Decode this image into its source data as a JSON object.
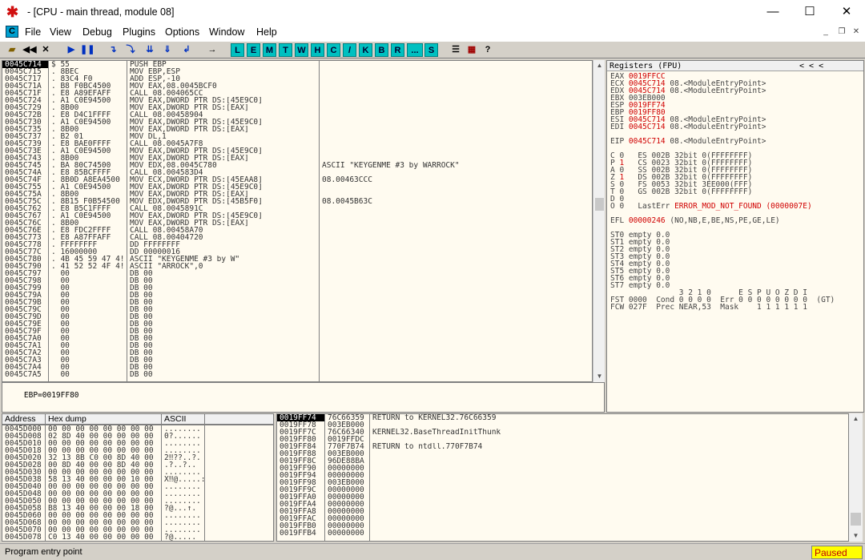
{
  "window": {
    "title": "- [CPU - main thread, module 08]",
    "minimize": "—",
    "maximize": "☐",
    "close": "✕"
  },
  "menu": {
    "c_icon": "C",
    "items": [
      "File",
      "View",
      "Debug",
      "Plugins",
      "Options",
      "Window",
      "Help"
    ],
    "mdi_min": "_",
    "mdi_restore": "❐",
    "mdi_close": "✕"
  },
  "toolbar": {
    "letters": [
      "L",
      "E",
      "M",
      "T",
      "W",
      "H",
      "C",
      "/",
      "K",
      "B",
      "R",
      "...",
      "S"
    ],
    "help": "?"
  },
  "cpu": {
    "rows": [
      {
        "addr": "0045C714",
        "hex": "$ 55",
        "asm": "PUSH EBP",
        "cmt": ""
      },
      {
        "addr": "0045C715",
        "hex": ". 8BEC",
        "asm": "MOV EBP,ESP",
        "cmt": ""
      },
      {
        "addr": "0045C717",
        "hex": ". 83C4 F0",
        "asm": "ADD ESP,-10",
        "cmt": ""
      },
      {
        "addr": "0045C71A",
        "hex": ". B8 F0BC4500",
        "asm": "MOV EAX,08.0045BCF0",
        "cmt": ""
      },
      {
        "addr": "0045C71F",
        "hex": ". E8 A89EFAFF",
        "asm": "CALL 08.004065CC",
        "cmt": ""
      },
      {
        "addr": "0045C724",
        "hex": ". A1 C0E94500",
        "asm": "MOV EAX,DWORD PTR DS:[45E9C0]",
        "cmt": ""
      },
      {
        "addr": "0045C729",
        "hex": ". 8B00",
        "asm": "MOV EAX,DWORD PTR DS:[EAX]",
        "cmt": ""
      },
      {
        "addr": "0045C72B",
        "hex": ". E8 D4C1FFFF",
        "asm": "CALL 08.00458904",
        "cmt": ""
      },
      {
        "addr": "0045C730",
        "hex": ". A1 C0E94500",
        "asm": "MOV EAX,DWORD PTR DS:[45E9C0]",
        "cmt": ""
      },
      {
        "addr": "0045C735",
        "hex": ". 8B00",
        "asm": "MOV EAX,DWORD PTR DS:[EAX]",
        "cmt": ""
      },
      {
        "addr": "0045C737",
        "hex": ". B2 01",
        "asm": "MOV DL,1",
        "cmt": ""
      },
      {
        "addr": "0045C739",
        "hex": ". E8 BAE0FFFF",
        "asm": "CALL 08.0045A7F8",
        "cmt": ""
      },
      {
        "addr": "0045C73E",
        "hex": ". A1 C0E94500",
        "asm": "MOV EAX,DWORD PTR DS:[45E9C0]",
        "cmt": ""
      },
      {
        "addr": "0045C743",
        "hex": ". 8B00",
        "asm": "MOV EAX,DWORD PTR DS:[EAX]",
        "cmt": ""
      },
      {
        "addr": "0045C745",
        "hex": ". BA 80C74500",
        "asm": "MOV EDX,08.0045C780",
        "cmt": "ASCII \"KEYGENME #3 by WARROCK\""
      },
      {
        "addr": "0045C74A",
        "hex": ". E8 85BCFFFF",
        "asm": "CALL 08.004583D4",
        "cmt": ""
      },
      {
        "addr": "0045C74F",
        "hex": ". 8B0D A8EA4500",
        "asm": "MOV ECX,DWORD PTR DS:[45EAA8]",
        "cmt": "08.00463CCC"
      },
      {
        "addr": "0045C755",
        "hex": ". A1 C0E94500",
        "asm": "MOV EAX,DWORD PTR DS:[45E9C0]",
        "cmt": ""
      },
      {
        "addr": "0045C75A",
        "hex": ". 8B00",
        "asm": "MOV EAX,DWORD PTR DS:[EAX]",
        "cmt": ""
      },
      {
        "addr": "0045C75C",
        "hex": ". 8B15 F0B54500",
        "asm": "MOV EDX,DWORD PTR DS:[45B5F0]",
        "cmt": "08.0045B63C"
      },
      {
        "addr": "0045C762",
        "hex": ". E8 B5C1FFFF",
        "asm": "CALL 08.0045891C",
        "cmt": ""
      },
      {
        "addr": "0045C767",
        "hex": ". A1 C0E94500",
        "asm": "MOV EAX,DWORD PTR DS:[45E9C0]",
        "cmt": ""
      },
      {
        "addr": "0045C76C",
        "hex": ". 8B00",
        "asm": "MOV EAX,DWORD PTR DS:[EAX]",
        "cmt": ""
      },
      {
        "addr": "0045C76E",
        "hex": ". E8 FDC2FFFF",
        "asm": "CALL 08.00458A70",
        "cmt": ""
      },
      {
        "addr": "0045C773",
        "hex": ". E8 A87FFAFF",
        "asm": "CALL 08.00404720",
        "cmt": ""
      },
      {
        "addr": "0045C778",
        "hex": ". FFFFFFFF",
        "asm": "DD FFFFFFFF",
        "cmt": ""
      },
      {
        "addr": "0045C77C",
        "hex": ". 16000000",
        "asm": "DD 00000016",
        "cmt": ""
      },
      {
        "addr": "0045C780",
        "hex": ". 4B 45 59 47 4!",
        "asm": "ASCII \"KEYGENME #3 by W\"",
        "cmt": ""
      },
      {
        "addr": "0045C790",
        "hex": ". 41 52 52 4F 4!",
        "asm": "ASCII \"ARROCK\",0",
        "cmt": ""
      },
      {
        "addr": "0045C797",
        "hex": "  00",
        "asm": "DB 00",
        "cmt": ""
      },
      {
        "addr": "0045C798",
        "hex": "  00",
        "asm": "DB 00",
        "cmt": ""
      },
      {
        "addr": "0045C799",
        "hex": "  00",
        "asm": "DB 00",
        "cmt": ""
      },
      {
        "addr": "0045C79A",
        "hex": "  00",
        "asm": "DB 00",
        "cmt": ""
      },
      {
        "addr": "0045C79B",
        "hex": "  00",
        "asm": "DB 00",
        "cmt": ""
      },
      {
        "addr": "0045C79C",
        "hex": "  00",
        "asm": "DB 00",
        "cmt": ""
      },
      {
        "addr": "0045C79D",
        "hex": "  00",
        "asm": "DB 00",
        "cmt": ""
      },
      {
        "addr": "0045C79E",
        "hex": "  00",
        "asm": "DB 00",
        "cmt": ""
      },
      {
        "addr": "0045C79F",
        "hex": "  00",
        "asm": "DB 00",
        "cmt": ""
      },
      {
        "addr": "0045C7A0",
        "hex": "  00",
        "asm": "DB 00",
        "cmt": ""
      },
      {
        "addr": "0045C7A1",
        "hex": "  00",
        "asm": "DB 00",
        "cmt": ""
      },
      {
        "addr": "0045C7A2",
        "hex": "  00",
        "asm": "DB 00",
        "cmt": ""
      },
      {
        "addr": "0045C7A3",
        "hex": "  00",
        "asm": "DB 00",
        "cmt": ""
      },
      {
        "addr": "0045C7A4",
        "hex": "  00",
        "asm": "DB 00",
        "cmt": ""
      },
      {
        "addr": "0045C7A5",
        "hex": "  00",
        "asm": "DB 00",
        "cmt": ""
      }
    ]
  },
  "info": {
    "text": "EBP=0019FF80"
  },
  "registers": {
    "header": "Registers (FPU)",
    "nav": "<   <   <",
    "lines": [
      {
        "t": "EAX ",
        "v": "0019FFCC",
        "r": ""
      },
      {
        "t": "ECX ",
        "v": "0045C714",
        "r": " 08.<ModuleEntryPoint>"
      },
      {
        "t": "EDX ",
        "v": "0045C714",
        "r": " 08.<ModuleEntryPoint>"
      },
      {
        "t": "EBX 003EB000",
        "v": "",
        "r": ""
      },
      {
        "t": "ESP ",
        "v": "0019FF74",
        "r": ""
      },
      {
        "t": "EBP ",
        "v": "0019FF80",
        "r": ""
      },
      {
        "t": "ESI ",
        "v": "0045C714",
        "r": " 08.<ModuleEntryPoint>"
      },
      {
        "t": "EDI ",
        "v": "0045C714",
        "r": " 08.<ModuleEntryPoint>"
      },
      {
        "t": "",
        "v": "",
        "r": ""
      },
      {
        "t": "EIP ",
        "v": "0045C714",
        "r": " 08.<ModuleEntryPoint>"
      },
      {
        "t": "",
        "v": "",
        "r": ""
      },
      {
        "t": "C 0   ES 002B 32bit 0(FFFFFFFF)",
        "v": "",
        "r": ""
      },
      {
        "t": "P ",
        "v": "1",
        "r": "   CS 0023 32bit 0(FFFFFFFF)"
      },
      {
        "t": "A 0   SS 002B 32bit 0(FFFFFFFF)",
        "v": "",
        "r": ""
      },
      {
        "t": "Z ",
        "v": "1",
        "r": "   DS 002B 32bit 0(FFFFFFFF)"
      },
      {
        "t": "S 0   FS 0053 32bit 3EE000(FFF)",
        "v": "",
        "r": ""
      },
      {
        "t": "T 0   GS 002B 32bit 0(FFFFFFFF)",
        "v": "",
        "r": ""
      },
      {
        "t": "D 0",
        "v": "",
        "r": ""
      },
      {
        "t": "O 0   LastErr ",
        "v": "ERROR_MOD_NOT_FOUND (0000007E)",
        "r": ""
      },
      {
        "t": "",
        "v": "",
        "r": ""
      },
      {
        "t": "EFL ",
        "v": "00000246",
        "r": " (NO,NB,E,BE,NS,PE,GE,LE)"
      },
      {
        "t": "",
        "v": "",
        "r": ""
      },
      {
        "t": "ST0 empty 0.0",
        "v": "",
        "r": ""
      },
      {
        "t": "ST1 empty 0.0",
        "v": "",
        "r": ""
      },
      {
        "t": "ST2 empty 0.0",
        "v": "",
        "r": ""
      },
      {
        "t": "ST3 empty 0.0",
        "v": "",
        "r": ""
      },
      {
        "t": "ST4 empty 0.0",
        "v": "",
        "r": ""
      },
      {
        "t": "ST5 empty 0.0",
        "v": "",
        "r": ""
      },
      {
        "t": "ST6 empty 0.0",
        "v": "",
        "r": ""
      },
      {
        "t": "ST7 empty 0.0",
        "v": "",
        "r": ""
      },
      {
        "t": "               3 2 1 0      E S P U O Z D I",
        "v": "",
        "r": ""
      },
      {
        "t": "FST 0000  Cond 0 0 0 0  Err 0 0 0 0 0 0 0 0  (GT)",
        "v": "",
        "r": ""
      },
      {
        "t": "FCW 027F  Prec NEAR,53  Mask    1 1 1 1 1 1",
        "v": "",
        "r": ""
      }
    ]
  },
  "dump": {
    "headers": [
      "Address",
      "Hex dump",
      "ASCII"
    ],
    "rows": [
      {
        "addr": "0045D000",
        "hex": "00 00 00 00 00 00 00 00",
        "ascii": "........"
      },
      {
        "addr": "0045D008",
        "hex": "02 8D 40 00 00 00 00 00",
        "ascii": "0?......"
      },
      {
        "addr": "0045D010",
        "hex": "00 00 00 00 00 00 00 00",
        "ascii": "........"
      },
      {
        "addr": "0045D018",
        "hex": "00 00 00 00 00 00 00 00",
        "ascii": "........"
      },
      {
        "addr": "0045D020",
        "hex": "32 13 8B C0 00 8D 40 00",
        "ascii": "2‼??..?."
      },
      {
        "addr": "0045D028",
        "hex": "00 8D 40 00 00 8D 40 00",
        "ascii": ".?..?.."
      },
      {
        "addr": "0045D030",
        "hex": "00 00 00 00 00 00 00 00",
        "ascii": "........"
      },
      {
        "addr": "0045D038",
        "hex": "58 13 40 00 00 00 10 00",
        "ascii": "X‼@.....:"
      },
      {
        "addr": "0045D040",
        "hex": "00 00 00 00 00 00 00 00",
        "ascii": "........"
      },
      {
        "addr": "0045D048",
        "hex": "00 00 00 00 00 00 00 00",
        "ascii": "........"
      },
      {
        "addr": "0045D050",
        "hex": "00 00 00 00 00 00 00 00",
        "ascii": "........"
      },
      {
        "addr": "0045D058",
        "hex": "B8 13 40 00 00 00 18 00",
        "ascii": "?@...↑."
      },
      {
        "addr": "0045D060",
        "hex": "00 00 00 00 00 00 00 00",
        "ascii": "........"
      },
      {
        "addr": "0045D068",
        "hex": "00 00 00 00 00 00 00 00",
        "ascii": "........"
      },
      {
        "addr": "0045D070",
        "hex": "00 00 00 00 00 00 00 00",
        "ascii": "........"
      },
      {
        "addr": "0045D078",
        "hex": "C0 13 40 00 00 00 00 00",
        "ascii": "?@....."
      }
    ]
  },
  "stack": {
    "rows": [
      {
        "addr": "0019FF74",
        "val": "76C66359",
        "cmt": "RETURN to KERNEL32.76C66359"
      },
      {
        "addr": "0019FF78",
        "val": "003EB000",
        "cmt": ""
      },
      {
        "addr": "0019FF7C",
        "val": "76C66340",
        "cmt": "KERNEL32.BaseThreadInitThunk"
      },
      {
        "addr": "0019FF80",
        "val": "0019FFDC",
        "cmt": ""
      },
      {
        "addr": "0019FF84",
        "val": "770F7B74",
        "cmt": "RETURN to ntdll.770F7B74"
      },
      {
        "addr": "0019FF88",
        "val": "003EB000",
        "cmt": ""
      },
      {
        "addr": "0019FF8C",
        "val": "96DE88BA",
        "cmt": ""
      },
      {
        "addr": "0019FF90",
        "val": "00000000",
        "cmt": ""
      },
      {
        "addr": "0019FF94",
        "val": "00000000",
        "cmt": ""
      },
      {
        "addr": "0019FF98",
        "val": "003EB000",
        "cmt": ""
      },
      {
        "addr": "0019FF9C",
        "val": "00000000",
        "cmt": ""
      },
      {
        "addr": "0019FFA0",
        "val": "00000000",
        "cmt": ""
      },
      {
        "addr": "0019FFA4",
        "val": "00000000",
        "cmt": ""
      },
      {
        "addr": "0019FFA8",
        "val": "00000000",
        "cmt": ""
      },
      {
        "addr": "0019FFAC",
        "val": "00000000",
        "cmt": ""
      },
      {
        "addr": "0019FFB0",
        "val": "00000000",
        "cmt": ""
      },
      {
        "addr": "0019FFB4",
        "val": "00000000",
        "cmt": ""
      }
    ]
  },
  "status": {
    "text": "Program entry point",
    "state": "Paused"
  },
  "colors": {
    "accent": "#00c0c0",
    "highlight": "#d00000",
    "paused_bg": "#ffff00"
  }
}
